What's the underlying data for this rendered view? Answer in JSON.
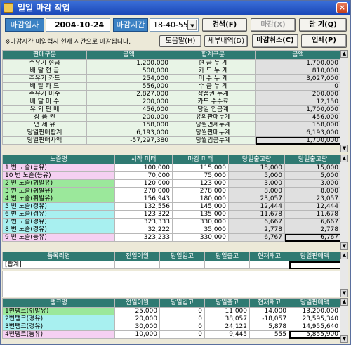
{
  "window": {
    "title": "일일 마감 작업",
    "close": "×"
  },
  "toolbar": {
    "date_label": "마감일자",
    "date_value": "2004-10-24",
    "time_label": "마감시간",
    "time_value": "18-40-55",
    "search": "검색(F)",
    "close_btn": "마감(X)",
    "exit": "닫 기(Q)"
  },
  "note": "※마감시간 미입력시 현재 시간으로 마감됩니다.",
  "help": "도움말(H)",
  "details": "세부내역(D)",
  "cancel": "마감취소(C)",
  "print": "인쇄(P)",
  "summary": {
    "headers": [
      "판매구분",
      "금액",
      "합계구분",
      "금액"
    ],
    "rows": [
      [
        "주유기 현금",
        "1,200,000",
        "현 금 누 계",
        "1,700,000"
      ],
      [
        "배 달 현 금",
        "500,000",
        "카 드 누 계",
        "810,000"
      ],
      [
        "주유기 카드",
        "254,000",
        "미 수 누 계",
        "3,027,000"
      ],
      [
        "배 달 카 드",
        "556,000",
        "수 금 누 계",
        "0"
      ],
      [
        "주유기 미수",
        "2,827,000",
        "상품권 누계",
        "200,000"
      ],
      [
        "배 달 미 수",
        "200,000",
        "카드 수수료",
        "12,150"
      ],
      [
        "유 외 판 매",
        "456,000",
        "당일 입금계",
        "1,700,000"
      ],
      [
        "상 품 권",
        "200,000",
        "유외판매누계",
        "456,000"
      ],
      [
        "면 세 유",
        "158,000",
        "당월면세누계",
        "158,000"
      ],
      [
        "당일판매합계",
        "6,193,000",
        "당월판매누계",
        "6,193,000"
      ],
      [
        "당일판매차액",
        "-57,297,380",
        "당월입금누계",
        "1,700,000"
      ]
    ]
  },
  "nozzles": {
    "headers": [
      "노즐명",
      "시작 미터",
      "마감 미터",
      "당일출고량",
      "당일출고량"
    ],
    "rows": [
      [
        "1 번 노즐(등유)",
        "100,000",
        "115,000",
        "15,000",
        "15,000"
      ],
      [
        "10 번 노즐(등유)",
        "70,000",
        "75,000",
        "5,000",
        "5,000"
      ],
      [
        "2 번 노즐(휘발유)",
        "120,000",
        "123,000",
        "3,000",
        "3,000"
      ],
      [
        "3 번 노즐(휘발유)",
        "270,000",
        "278,000",
        "8,000",
        "8,000"
      ],
      [
        "4 번 노즐(휘발유)",
        "156,943",
        "180,000",
        "23,057",
        "23,057"
      ],
      [
        "5 번 노즐(경유)",
        "132,556",
        "145,000",
        "12,444",
        "12,444"
      ],
      [
        "6 번 노즐(경유)",
        "123,322",
        "135,000",
        "11,678",
        "11,678"
      ],
      [
        "7 번 노즐(경유)",
        "323,333",
        "330,000",
        "6,667",
        "6,667"
      ],
      [
        "8 번 노즐(경유)",
        "32,222",
        "35,000",
        "2,778",
        "2,778"
      ],
      [
        "9 번 노즐(등유)",
        "323,233",
        "330,000",
        "6,767",
        "6,767"
      ]
    ]
  },
  "products": {
    "headers": [
      "품목리명",
      "전일이월",
      "당일입고",
      "당일출고",
      "현재재고",
      "당일판매액"
    ],
    "total": "[합계]"
  },
  "tanks": {
    "headers": [
      "탱크명",
      "전일이월",
      "당일입고",
      "당일출고",
      "현재재고",
      "당일판매액"
    ],
    "rows": [
      [
        "1번탱크(휘발유)",
        "25,000",
        "0",
        "11,000",
        "14,000",
        "13,200,000"
      ],
      [
        "2번탱크(경유)",
        "20,000",
        "0",
        "38,057",
        "-18,057",
        "23,595,340"
      ],
      [
        "3번탱크(경유)",
        "30,000",
        "0",
        "24,122",
        "5,878",
        "14,955,640"
      ],
      [
        "4번탱크(등유)",
        "10,000",
        "0",
        "9,445",
        "555",
        "5,855,900"
      ]
    ]
  }
}
